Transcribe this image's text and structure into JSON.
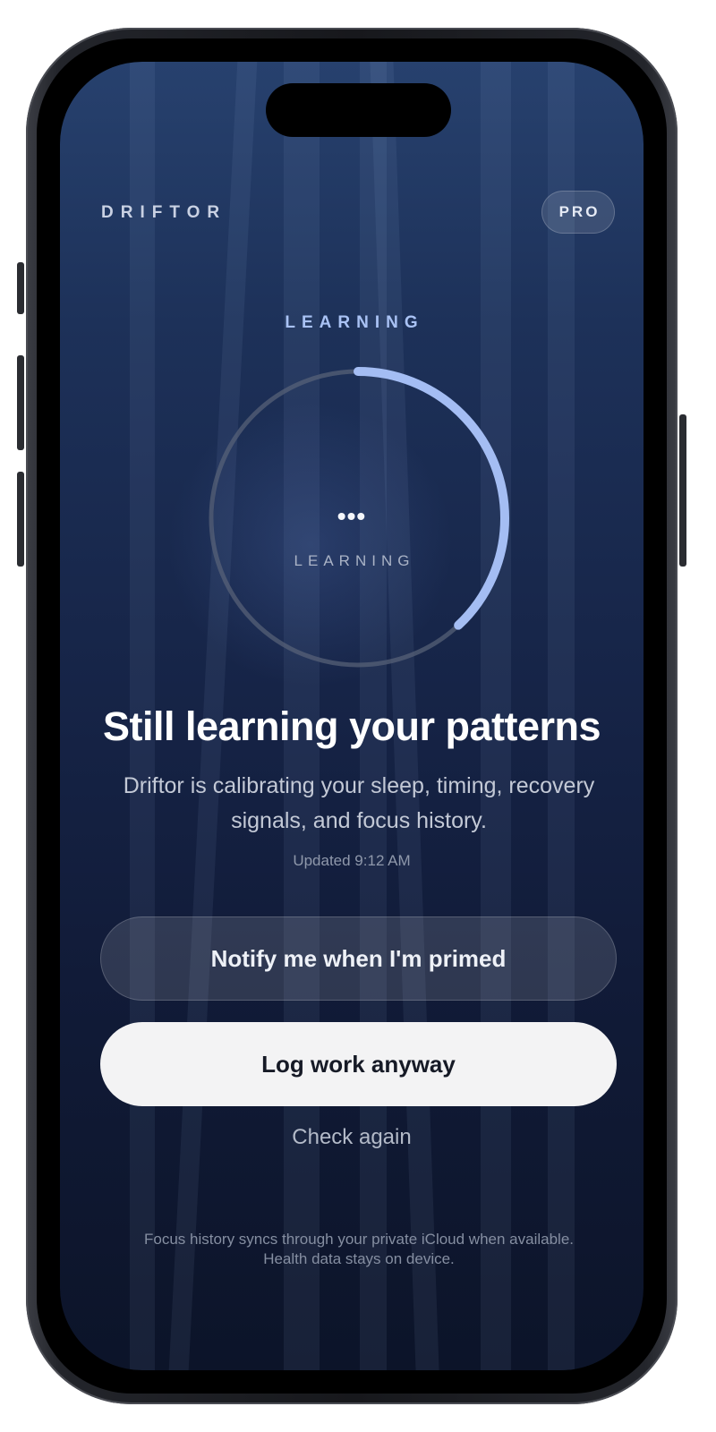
{
  "header": {
    "brand": "DRIFTOR",
    "badge": "PRO"
  },
  "status": {
    "eyebrow": "LEARNING",
    "ring_center": "•••",
    "ring_label": "LEARNING",
    "progress_fraction": 0.38
  },
  "main": {
    "headline": "Still learning your patterns",
    "subtitle": "Driftor is calibrating your sleep, timing, recovery signals, and focus history.",
    "updated": "Updated 9:12 AM"
  },
  "actions": {
    "notify_label": "Notify me when I'm primed",
    "log_label": "Log work anyway",
    "check_label": "Check again"
  },
  "footer": {
    "note": "Focus history syncs through your private iCloud when available. Health data stays on device."
  },
  "colors": {
    "accent": "#a4bdf3",
    "track": "#5a6479",
    "background_top": "#27416e",
    "background_bottom": "#0c1429"
  }
}
